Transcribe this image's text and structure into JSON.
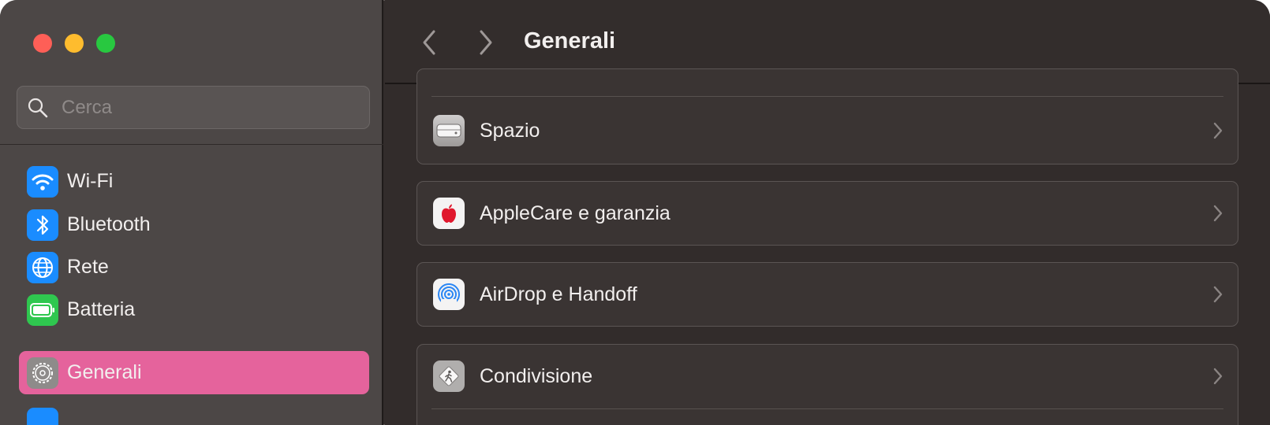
{
  "sidebar": {
    "search": {
      "placeholder": "Cerca",
      "value": ""
    },
    "items": [
      {
        "label": "Wi-Fi",
        "icon": "wifi-icon",
        "color": "#1a8cff"
      },
      {
        "label": "Bluetooth",
        "icon": "bluetooth-icon",
        "color": "#1a8cff"
      },
      {
        "label": "Rete",
        "icon": "globe-icon",
        "color": "#1a8cff"
      },
      {
        "label": "Batteria",
        "icon": "battery-icon",
        "color": "#2fc74f"
      },
      {
        "label": "Generali",
        "icon": "gear-icon",
        "color": "#8e8b8a",
        "selected": true
      }
    ]
  },
  "toolbar": {
    "title": "Generali"
  },
  "main": {
    "rows": [
      {
        "label": "Spazio",
        "icon": "storage-drive-icon"
      },
      {
        "label": "AppleCare e garanzia",
        "icon": "apple-logo-icon"
      },
      {
        "label": "AirDrop e Handoff",
        "icon": "airdrop-icon"
      },
      {
        "label": "Condivisione",
        "icon": "sharing-icon"
      }
    ]
  },
  "colors": {
    "accent": "#e5639c",
    "sidebar_bg": "#4c4746",
    "content_bg": "#322c2b",
    "card_bg": "#3a3433"
  }
}
